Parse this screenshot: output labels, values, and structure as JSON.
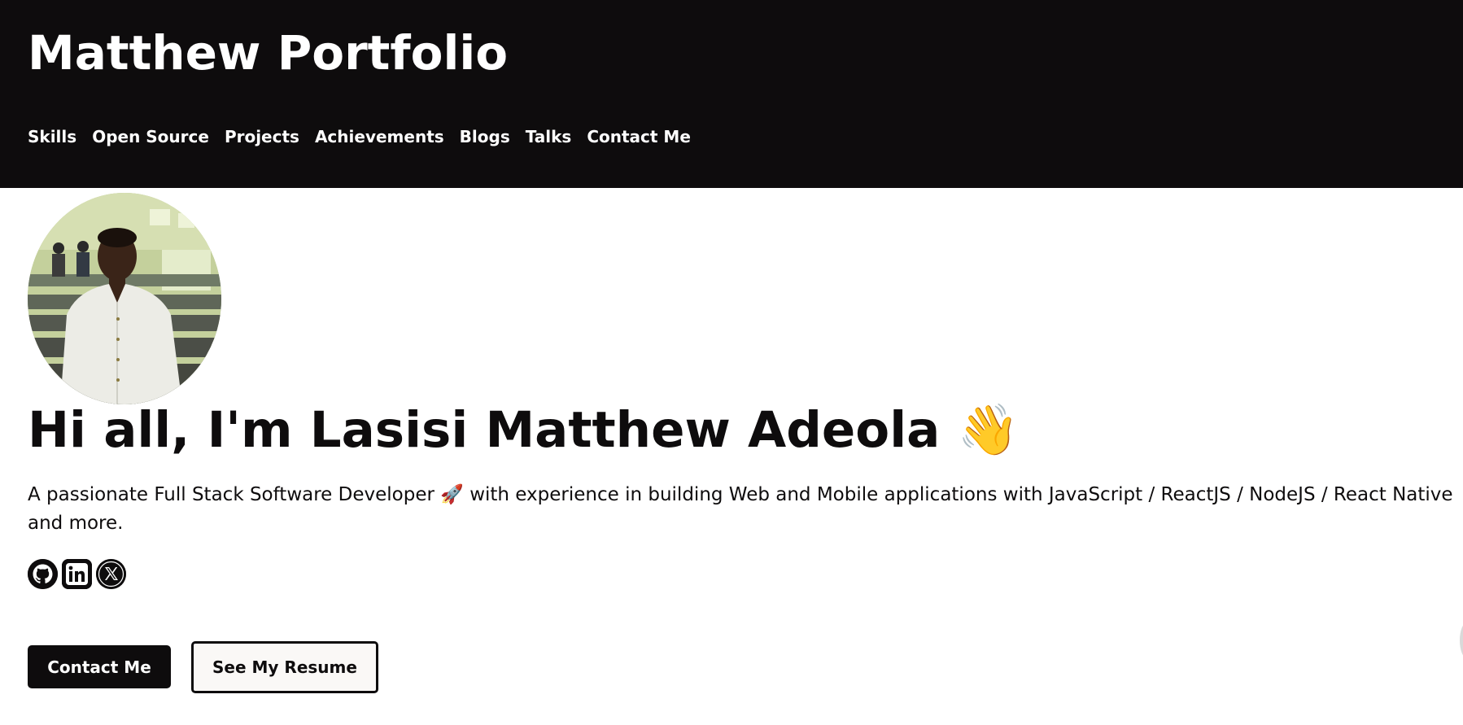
{
  "header": {
    "title": "Matthew Portfolio",
    "background": "#0e0c0d"
  },
  "nav": {
    "items": [
      {
        "label": "Skills"
      },
      {
        "label": "Open Source"
      },
      {
        "label": "Projects"
      },
      {
        "label": "Achievements"
      },
      {
        "label": "Blogs"
      },
      {
        "label": "Talks"
      },
      {
        "label": "Contact Me"
      }
    ]
  },
  "hero": {
    "greeting": "Hi all, I'm Lasisi Matthew Adeola 👋",
    "bio": "A passionate Full Stack Software Developer 🚀 with experience in building Web and Mobile applications with JavaScript / ReactJS / NodeJS / React Native\nand more.",
    "avatar_icon": "profile-photo"
  },
  "socials": [
    {
      "icon": "github-icon"
    },
    {
      "icon": "linkedin-icon"
    },
    {
      "icon": "x-twitter-icon"
    }
  ],
  "buttons": {
    "contact_label": "Contact Me",
    "resume_label": "See My Resume"
  },
  "colors": {
    "primary": "#0e0c0d",
    "text_light": "#ffffff",
    "outline_bg": "#faf8f6"
  }
}
